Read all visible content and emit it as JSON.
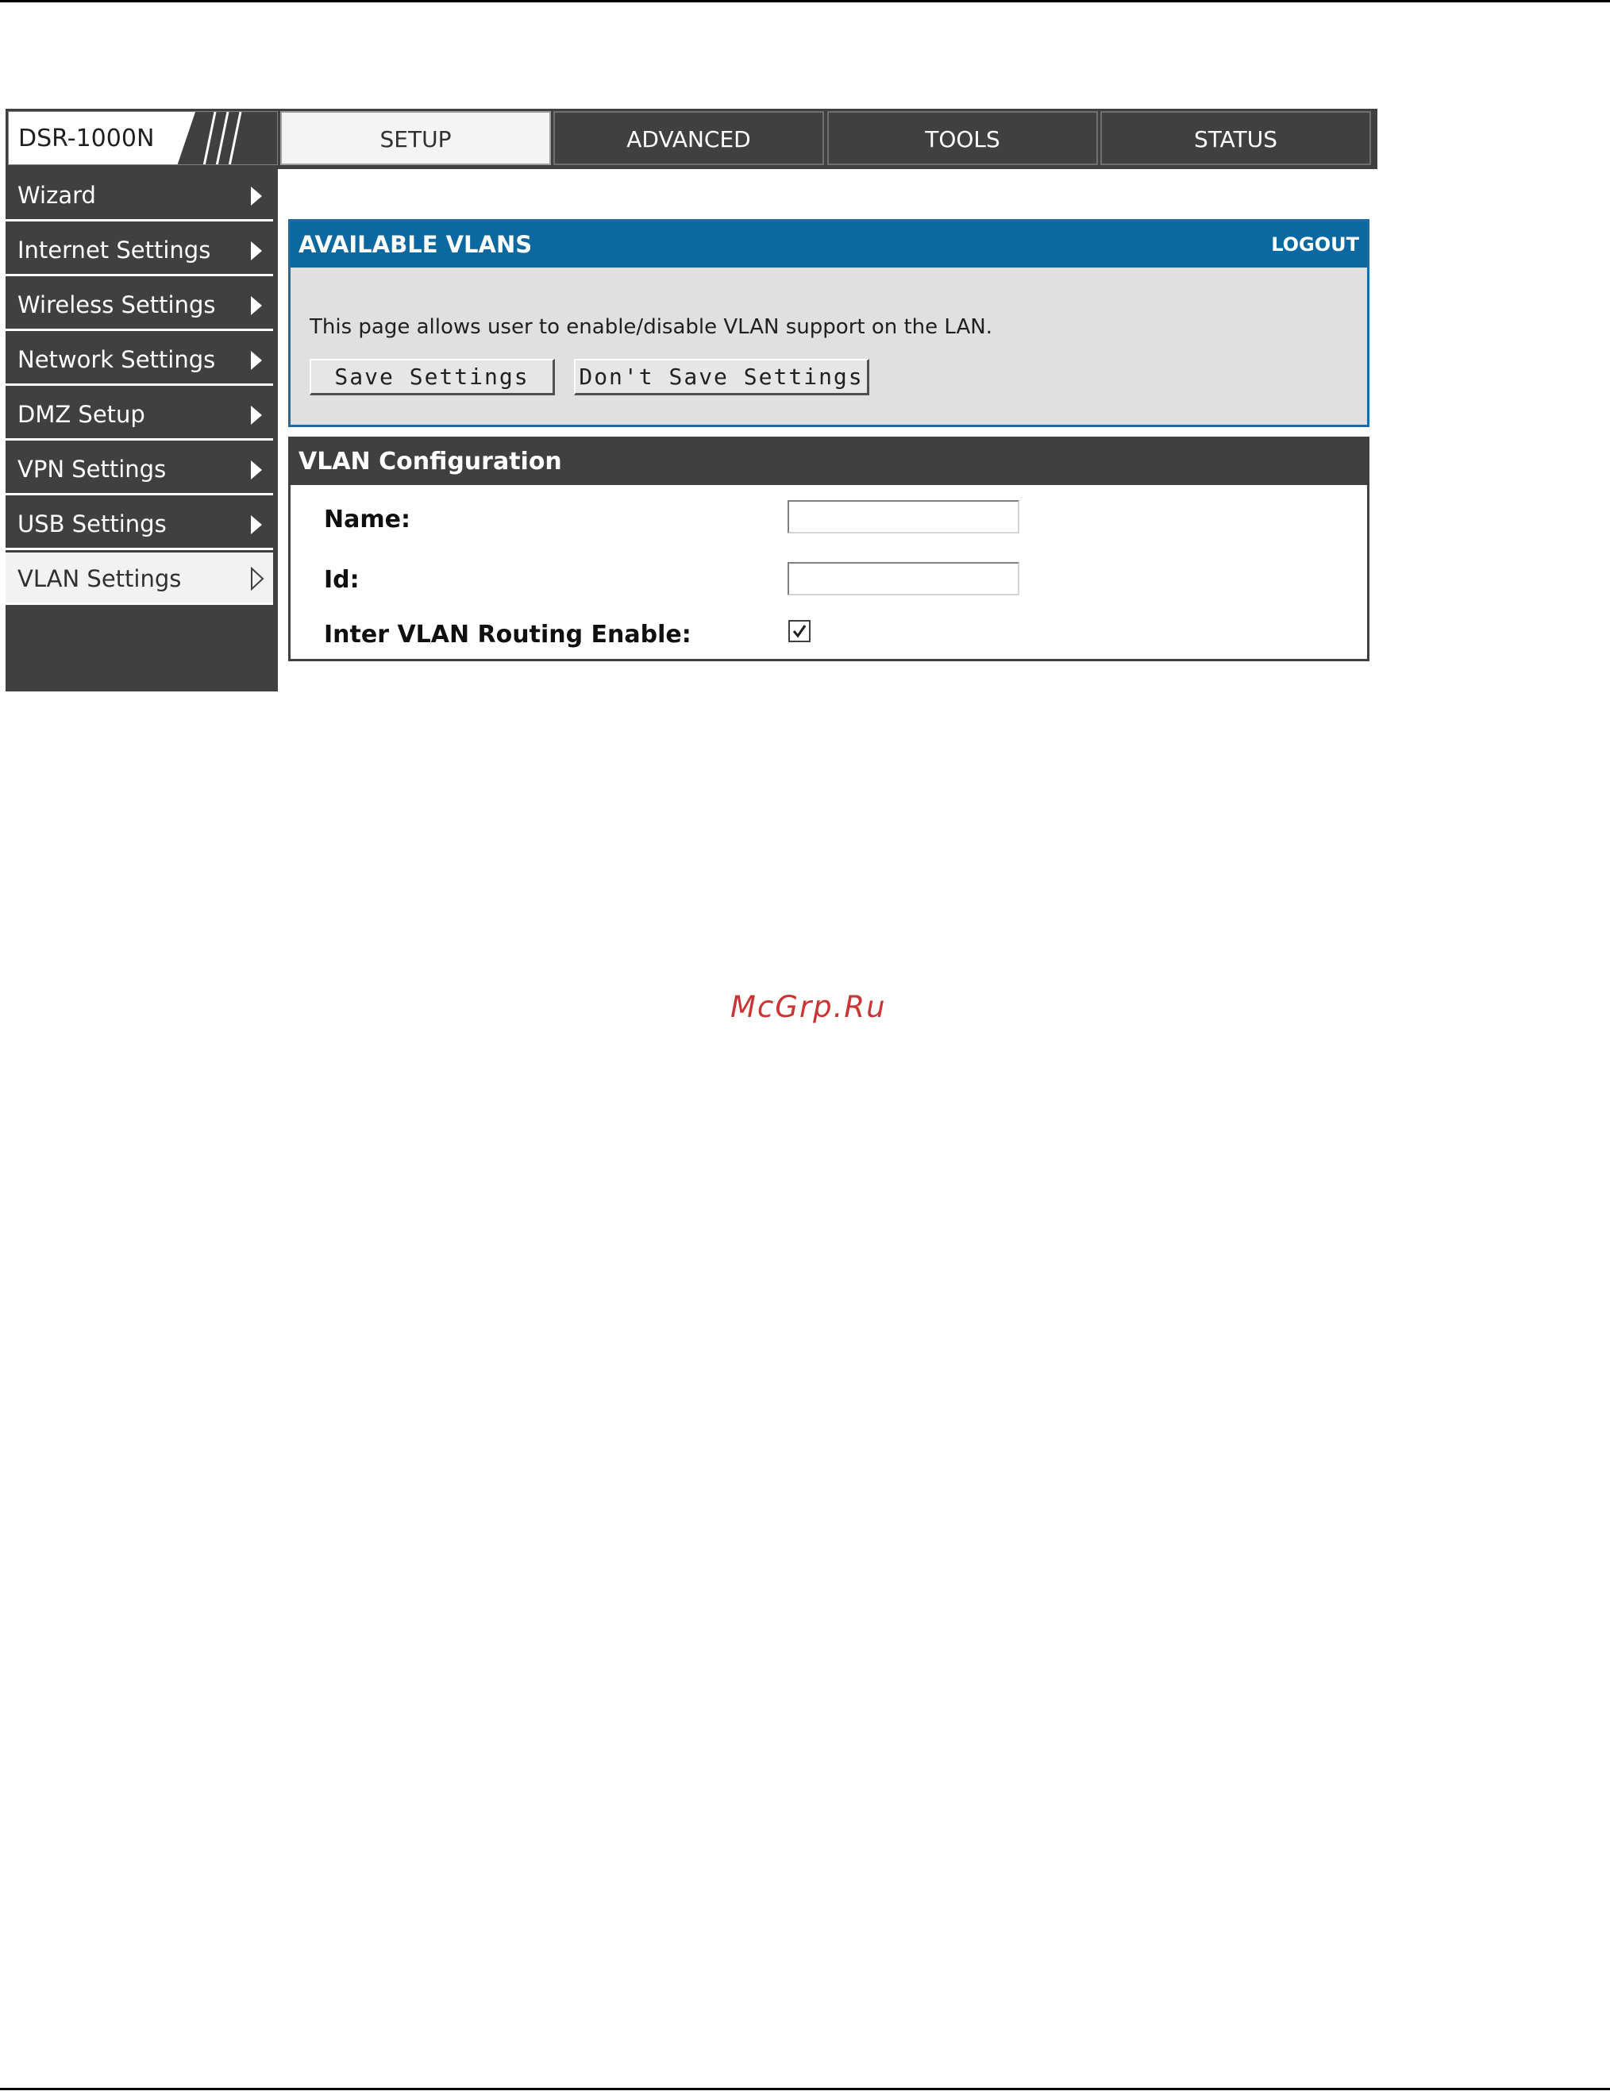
{
  "header": {
    "model": "DSR-1000N",
    "tabs": [
      {
        "label": "SETUP",
        "active": true
      },
      {
        "label": "ADVANCED",
        "active": false
      },
      {
        "label": "TOOLS",
        "active": false
      },
      {
        "label": "STATUS",
        "active": false
      }
    ]
  },
  "sidebar": {
    "items": [
      {
        "label": "Wizard",
        "icon": "chevron-right-icon"
      },
      {
        "label": "Internet Settings",
        "icon": "chevron-right-icon"
      },
      {
        "label": "Wireless Settings",
        "icon": "chevron-right-icon"
      },
      {
        "label": "Network Settings",
        "icon": "chevron-right-icon"
      },
      {
        "label": "DMZ Setup",
        "icon": "chevron-right-icon"
      },
      {
        "label": "VPN Settings",
        "icon": "chevron-right-icon"
      },
      {
        "label": "USB Settings",
        "icon": "chevron-right-icon"
      },
      {
        "label": "VLAN Settings",
        "icon": "chevron-right-outline-icon",
        "active": true
      }
    ]
  },
  "available_vlans": {
    "title": "AVAILABLE VLANS",
    "logout": "LOGOUT",
    "description": "This page allows user to enable/disable VLAN support on the LAN.",
    "save_label": "Save Settings",
    "dont_save_label": "Don't Save Settings"
  },
  "vlan_config": {
    "title": "VLAN Configuration",
    "name_label": "Name:",
    "name_value": "",
    "id_label": "Id:",
    "id_value": "",
    "routing_label": "Inter VLAN Routing Enable:",
    "routing_checked": true
  },
  "watermark": "McGrp.Ru",
  "colors": {
    "header_dark": "#404040",
    "panel_blue": "#0b68a1",
    "panel_grey": "#e0e0e0",
    "watermark": "#cc3333"
  }
}
